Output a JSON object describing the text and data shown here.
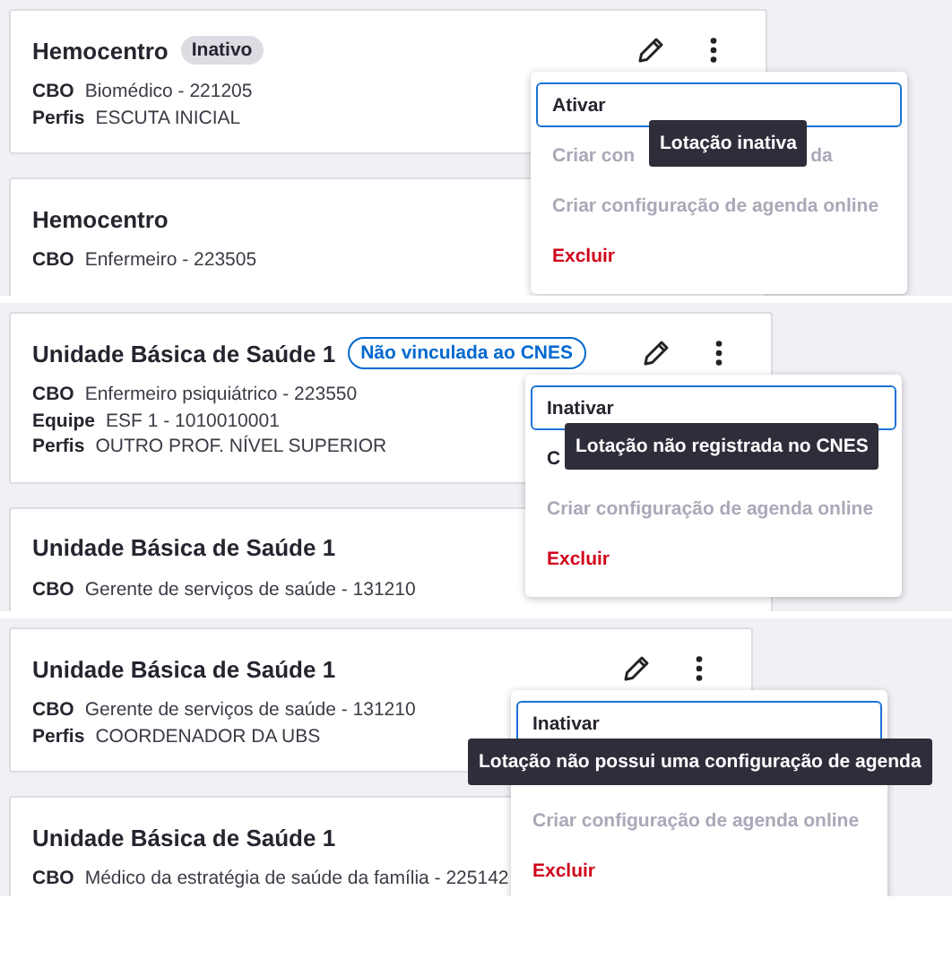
{
  "panels": [
    {
      "cards": [
        {
          "title": "Hemocentro",
          "badge": {
            "text": "Inativo",
            "kind": "inactive"
          },
          "fields": [
            {
              "label": "CBO",
              "value": "Biomédico - 221205"
            },
            {
              "label": "Perfis",
              "value": "ESCUTA INICIAL"
            }
          ]
        },
        {
          "title": "Hemocentro",
          "fields": [
            {
              "label": "CBO",
              "value": "Enfermeiro - 223505"
            }
          ]
        }
      ],
      "menu": {
        "items": [
          {
            "kind": "focused",
            "parts": [
              "Ativar"
            ]
          },
          {
            "kind": "disabled",
            "parts": [
              "Criar con",
              "da"
            ]
          },
          {
            "kind": "disabled",
            "parts": [
              "Criar configuração de agenda online"
            ]
          },
          {
            "kind": "danger",
            "parts": [
              "Excluir"
            ]
          }
        ],
        "tooltip": "Lotação inativa"
      }
    },
    {
      "cards": [
        {
          "title": "Unidade Básica de Saúde 1",
          "badge": {
            "text": "Não vinculada ao CNES",
            "kind": "cnes"
          },
          "fields": [
            {
              "label": "CBO",
              "value": "Enfermeiro psiquiátrico - 223550"
            },
            {
              "label": "Equipe",
              "value": "ESF 1 - 1010010001"
            },
            {
              "label": "Perfis",
              "value": "OUTRO PROF. NÍVEL SUPERIOR"
            }
          ]
        },
        {
          "title": "Unidade Básica de Saúde 1",
          "fields": [
            {
              "label": "CBO",
              "value": "Gerente de serviços de saúde - 131210"
            }
          ]
        }
      ],
      "menu": {
        "items": [
          {
            "kind": "focused",
            "parts": [
              "Inativar"
            ]
          },
          {
            "kind": "normal",
            "parts": [
              "C"
            ]
          },
          {
            "kind": "disabled",
            "parts": [
              "Criar configuração de agenda online"
            ]
          },
          {
            "kind": "danger",
            "parts": [
              "Excluir"
            ]
          }
        ],
        "tooltip": "Lotação não registrada no CNES"
      }
    },
    {
      "cards": [
        {
          "title": "Unidade Básica de Saúde 1",
          "fields": [
            {
              "label": "CBO",
              "value": "Gerente de serviços de saúde - 131210"
            },
            {
              "label": "Perfis",
              "value": "COORDENADOR DA UBS"
            }
          ]
        },
        {
          "title": "Unidade Básica de Saúde 1",
          "fields": [
            {
              "label": "CBO",
              "value": "Médico da estratégia de saúde da família - 225142"
            }
          ]
        }
      ],
      "menu": {
        "items": [
          {
            "kind": "focused",
            "parts": [
              "Inativar"
            ]
          },
          {
            "kind": "disabled",
            "parts": [
              "Criar configuração de agenda online"
            ]
          },
          {
            "kind": "danger",
            "parts": [
              "Excluir"
            ]
          }
        ],
        "tooltip": "Lotação não possui uma configuração de agenda"
      }
    }
  ]
}
